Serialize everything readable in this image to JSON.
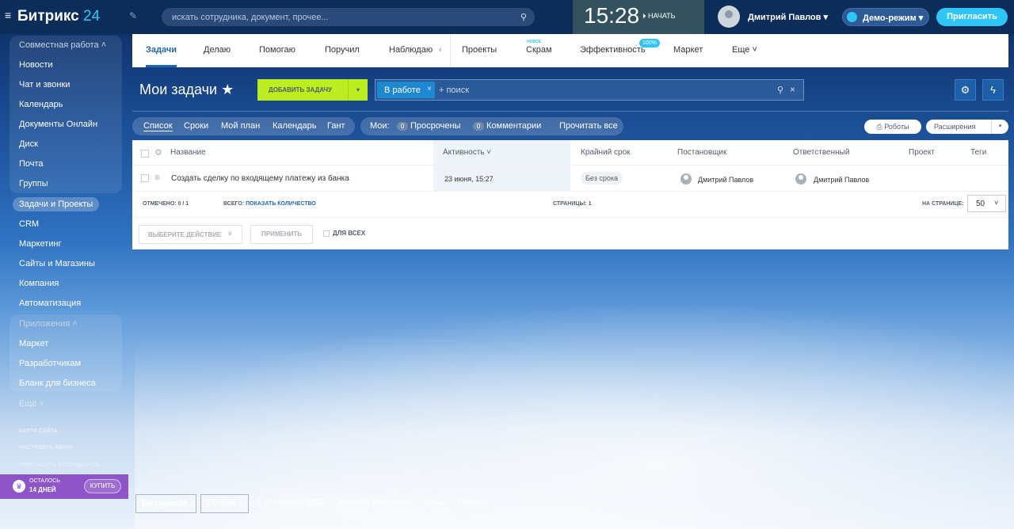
{
  "topbar": {
    "logo_main": "Битрикс",
    "logo_num": "24",
    "search_placeholder": "искать сотрудника, документ, прочее...",
    "time": "15:28",
    "start_label": "НАЧАТЬ",
    "user_name": "Дмитрий Павлов",
    "demo_label": "Демо-режим",
    "invite_label": "Пригласить"
  },
  "sidebar": {
    "group1_title": "Совместная работа",
    "group1_items": [
      "Новости",
      "Чат и звонки",
      "Календарь",
      "Документы Онлайн",
      "Диск",
      "Почта",
      "Группы"
    ],
    "items": [
      "Задачи и Проекты",
      "CRM",
      "Маркетинг",
      "Сайты и Магазины",
      "Компания",
      "Автоматизация"
    ],
    "group2_title": "Приложения",
    "group2_items": [
      "Маркет",
      "Разработчикам",
      "Бланк для бизнеса"
    ],
    "more": "Ещё",
    "links": [
      "КАРТА САЙТА",
      "НАСТРОИТЬ МЕНЮ",
      "ПРИГЛАСИТЬ СОТРУДНИКОВ"
    ],
    "trial": {
      "line1": "ОСТАЛОСЬ",
      "line2": "14 ДНЕЙ",
      "buy": "КУПИТЬ"
    }
  },
  "tabs": {
    "items": [
      "Задачи",
      "Делаю",
      "Помогаю",
      "Поручил",
      "Наблюдаю",
      "Проекты",
      "Скрам",
      "Эффективность",
      "Маркет",
      "Еще"
    ],
    "new_badge": "НОВОЕ",
    "pct_badge": "100%"
  },
  "toolbar": {
    "title": "Мои задачи",
    "add_task": "ДОБАВИТЬ ЗАДАЧУ",
    "filter_chip": "В работе",
    "filter_placeholder": "+ поиск"
  },
  "views": {
    "items": [
      "Список",
      "Сроки",
      "Мой план",
      "Календарь",
      "Гант"
    ],
    "my_label": "Мои:",
    "overdue_count": "0",
    "overdue_label": "Просрочены",
    "comments_count": "0",
    "comments_label": "Комментарии",
    "read_all": "Прочитать все",
    "robots": "Роботы",
    "extensions": "Расширения"
  },
  "grid": {
    "columns": [
      "Название",
      "Активность",
      "Крайний срок",
      "Постановщик",
      "Ответственный",
      "Проект",
      "Теги"
    ],
    "rows": [
      {
        "name": "Создать сделку по входящему платежу из банка",
        "activity": "23 июня, 15:27",
        "deadline": "Без срока",
        "creator": "Дмитрий Павлов",
        "responsible": "Дмитрий Павлов"
      }
    ],
    "marked_label": "ОТМЕЧЕНО: 0 / 1",
    "total_label": "ВСЕГО:",
    "total_link": "ПОКАЗАТЬ КОЛИЧЕСТВО",
    "pages_label": "СТРАНИЦЫ: 1",
    "per_page_label": "НА СТРАНИЦЕ:",
    "per_page_value": "50",
    "action_select": "ВЫБЕРИТЕ ДЕЙСТВИЕ",
    "apply": "ПРИМЕНИТЬ",
    "for_all": "ДЛЯ ВСЕХ"
  },
  "footer": {
    "logo": "Битрикс24",
    "language": "Русский",
    "copyright": "© «Битрикс», 2022",
    "links": [
      "Заказать внедрение",
      "Темы",
      "Печать"
    ]
  }
}
